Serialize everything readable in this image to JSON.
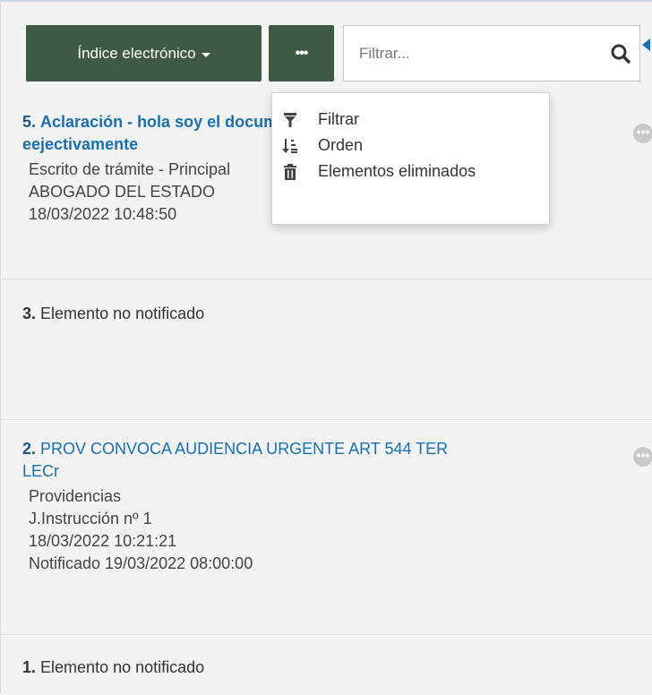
{
  "toolbar": {
    "index_button_label": "Índice electrónico",
    "more_button_label": "•••",
    "search_placeholder": "Filtrar..."
  },
  "menu": {
    "items": [
      {
        "label": "Filtrar",
        "icon": "filter-icon"
      },
      {
        "label": "Orden",
        "icon": "sort-icon"
      },
      {
        "label": "Elementos eliminados",
        "icon": "trash-icon"
      }
    ]
  },
  "documents": [
    {
      "number": "5.",
      "title_line1": "Aclaración - hola soy el documento",
      "title_line2": "eejectivamente",
      "type": "Escrito de trámite - Principal",
      "author": "ABOGADO DEL ESTADO",
      "date": "18/03/2022 10:48:50",
      "notified": ""
    },
    {
      "number": "3.",
      "text": "Elemento no notificado"
    },
    {
      "number": "2.",
      "title_line1": "PROV CONVOCA AUDIENCIA URGENTE ART 544 TER",
      "title_line2": "LECr",
      "type": "Providencias",
      "author": "J.Instrucción nº 1",
      "date": "18/03/2022 10:21:21",
      "notified": "Notificado 19/03/2022 08:00:00"
    },
    {
      "number": "1.",
      "text": "Elemento no notificado"
    }
  ],
  "icons": {
    "search": "search-icon",
    "options": "more-options-icon",
    "back_arrow": "arrow-left-icon"
  },
  "colors": {
    "button_bg": "#3e5a45",
    "link": "#1a6fb0",
    "panel_bg": "#f3f3f3"
  }
}
